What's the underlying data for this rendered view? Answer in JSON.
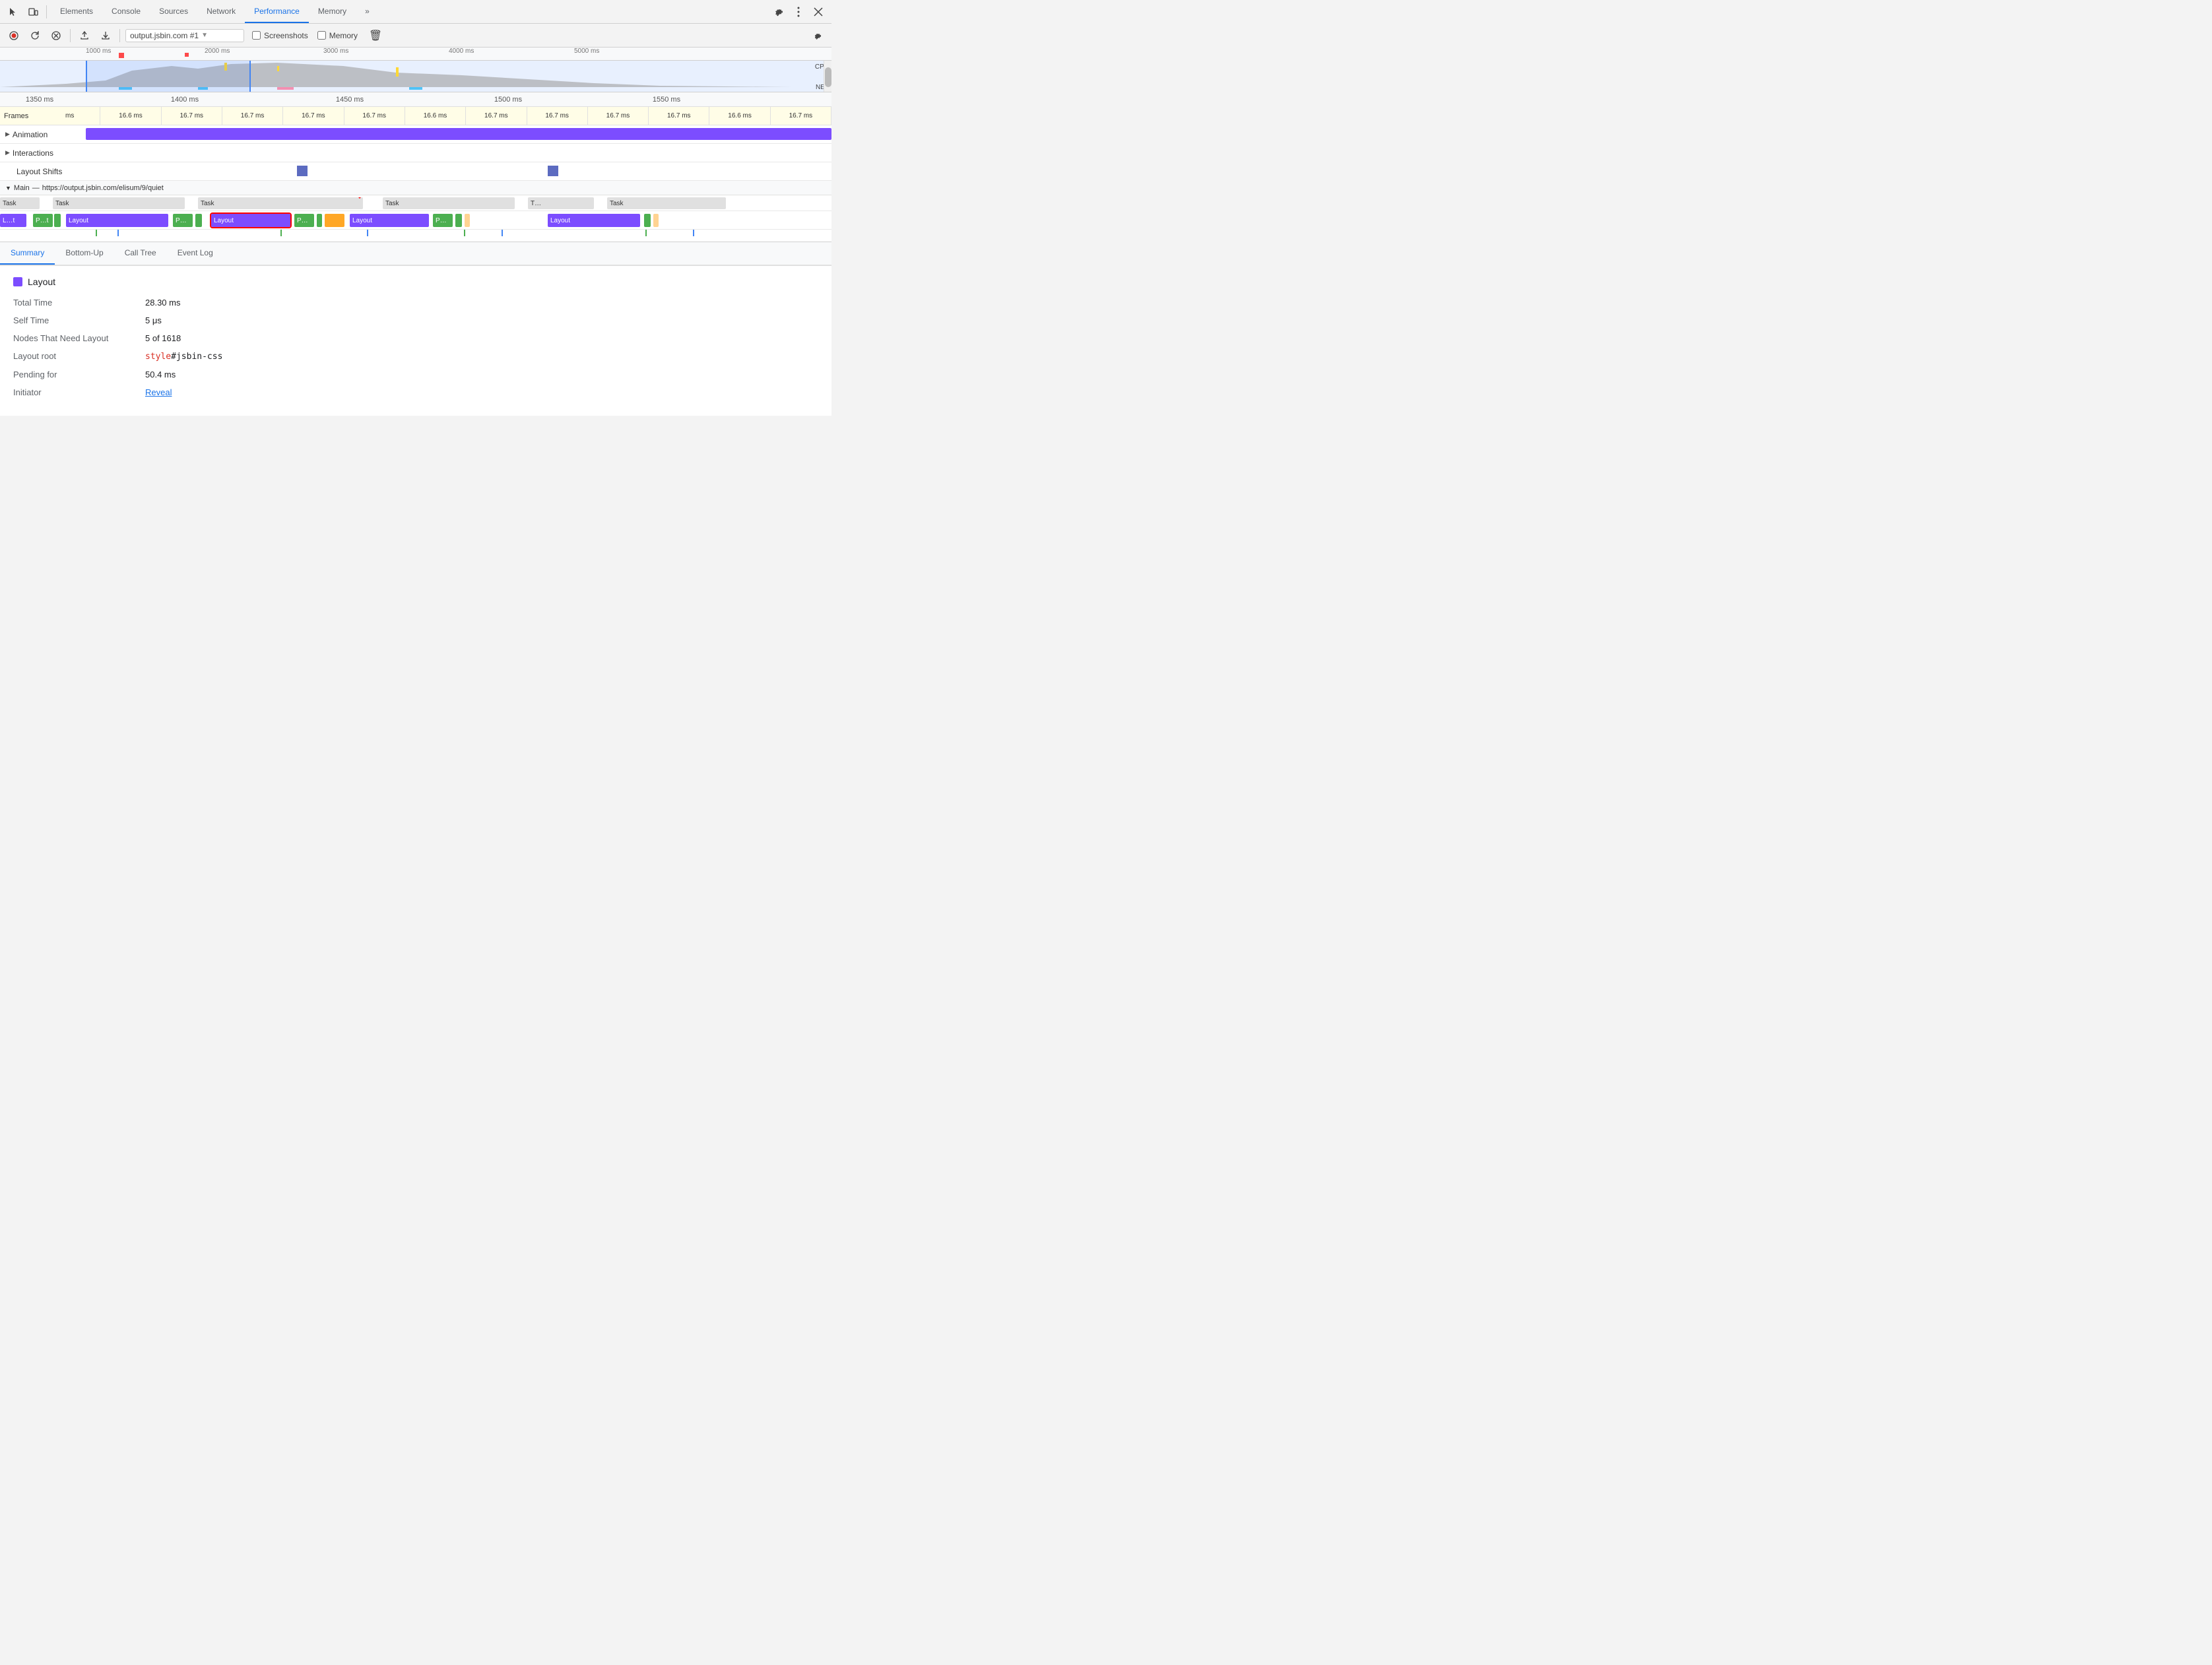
{
  "nav": {
    "tabs": [
      {
        "id": "elements",
        "label": "Elements",
        "active": false
      },
      {
        "id": "console",
        "label": "Console",
        "active": false
      },
      {
        "id": "sources",
        "label": "Sources",
        "active": false
      },
      {
        "id": "network",
        "label": "Network",
        "active": false
      },
      {
        "id": "performance",
        "label": "Performance",
        "active": true
      },
      {
        "id": "memory",
        "label": "Memory",
        "active": false
      },
      {
        "id": "more",
        "label": "»",
        "active": false
      }
    ],
    "settings_tooltip": "Settings",
    "more_options_tooltip": "More options",
    "close_tooltip": "Close"
  },
  "toolbar": {
    "record_label": "Record",
    "refresh_label": "Reload",
    "clear_label": "Clear",
    "upload_label": "Load profile",
    "download_label": "Save profile",
    "url": "output.jsbin.com #1",
    "screenshots_label": "Screenshots",
    "memory_label": "Memory",
    "capture_settings_tooltip": "Capture settings"
  },
  "overview": {
    "ruler_marks": [
      "1000 ms",
      "2000 ms",
      "3000 ms",
      "4000 ms",
      "5000 ms"
    ],
    "cpu_label": "CPU",
    "net_label": "NET"
  },
  "detail": {
    "ruler_marks": [
      "1350 ms",
      "1400 ms",
      "1450 ms",
      "1500 ms",
      "1550 ms"
    ],
    "frames": {
      "label": "Frames",
      "cells": [
        "ms",
        "16.6 ms",
        "16.7 ms",
        "16.7 ms",
        "16.7 ms",
        "16.7 ms",
        "16.6 ms",
        "16.7 ms",
        "16.7 ms",
        "16.7 ms",
        "16.7 ms",
        "16.6 ms",
        "16.7 ms"
      ]
    },
    "animation_label": "Animation",
    "interactions_label": "Interactions",
    "layout_shifts_label": "Layout Shifts",
    "main_label": "Main",
    "main_url": "https://output.jsbin.com/elisum/9/quiet"
  },
  "bottom_tabs": [
    {
      "id": "summary",
      "label": "Summary",
      "active": true
    },
    {
      "id": "bottom-up",
      "label": "Bottom-Up",
      "active": false
    },
    {
      "id": "call-tree",
      "label": "Call Tree",
      "active": false
    },
    {
      "id": "event-log",
      "label": "Event Log",
      "active": false
    }
  ],
  "summary": {
    "title": "Layout",
    "color": "#7c4dff",
    "rows": [
      {
        "key": "Total Time",
        "value": "28.30 ms",
        "type": "text"
      },
      {
        "key": "Self Time",
        "value": "5 μs",
        "type": "text"
      },
      {
        "key": "Nodes That Need Layout",
        "value": "5 of 1618",
        "type": "text"
      },
      {
        "key": "Layout root",
        "value_prefix": "",
        "value_code_red": "style",
        "value_code_normal": "#jsbin-css",
        "type": "code"
      },
      {
        "key": "Pending for",
        "value": "50.4 ms",
        "type": "text"
      },
      {
        "key": "Initiator",
        "value": "Reveal",
        "type": "link"
      }
    ]
  }
}
